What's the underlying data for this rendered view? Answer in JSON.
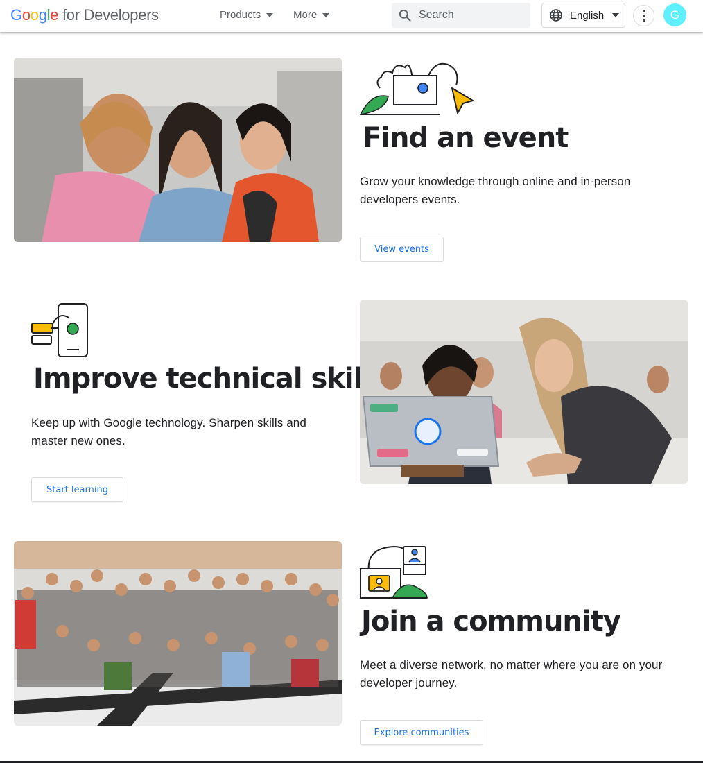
{
  "header": {
    "logo_google": [
      "G",
      "o",
      "o",
      "g",
      "l",
      "e"
    ],
    "logo_rest": " for Developers",
    "nav": [
      {
        "label": "Products"
      },
      {
        "label": "More"
      }
    ],
    "search_placeholder": "Search",
    "language": "English",
    "avatar_initial": "G"
  },
  "sections": [
    {
      "title": "Find an event",
      "description": "Grow your knowledge through online and in-person developers events.",
      "button": "View events"
    },
    {
      "title": "Improve technical skills",
      "description": "Keep up with Google technology. Sharpen skills and master new ones.",
      "button": "Start learning"
    },
    {
      "title": "Join a community",
      "description": "Meet a diverse network, no matter where you are on your developer journey.",
      "button": "Explore communities"
    }
  ],
  "colors": {
    "accent": "#1a73e8",
    "illustration_yellow": "#fbbc04",
    "illustration_green": "#34a853",
    "illustration_blue": "#4285f4",
    "avatar_bg": "#5ef0ff"
  },
  "icons": [
    "search-icon",
    "globe-icon",
    "chevron-down-icon",
    "more-vert-icon"
  ]
}
